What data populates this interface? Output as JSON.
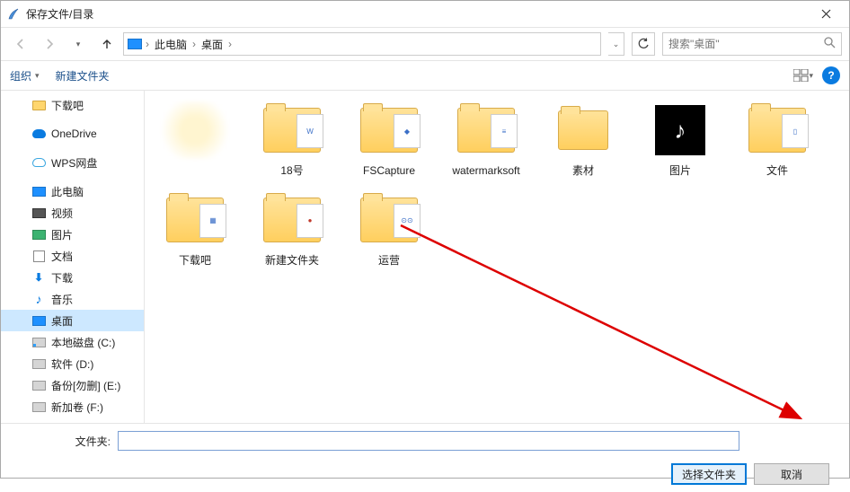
{
  "window": {
    "title": "保存文件/目录"
  },
  "breadcrumb": {
    "root": "此电脑",
    "current": "桌面"
  },
  "search": {
    "placeholder": "搜索\"桌面\""
  },
  "toolbar": {
    "organize": "组织",
    "newfolder": "新建文件夹"
  },
  "tree": {
    "downloads": "下载吧",
    "onedrive": "OneDrive",
    "wps": "WPS网盘",
    "pc": "此电脑",
    "video": "视频",
    "pictures": "图片",
    "documents": "文档",
    "downloads2": "下载",
    "music": "音乐",
    "desktop": "桌面",
    "driveC": "本地磁盘 (C:)",
    "driveD": "软件 (D:)",
    "driveE": "备份[勿删] (E:)",
    "driveF": "新加卷 (F:)"
  },
  "items": {
    "i1": "18号",
    "i2": "FSCapture",
    "i3": "watermarksoft",
    "i4": "素材",
    "i5": "图片",
    "i6": "文件",
    "i7": "下载吧",
    "i8": "新建文件夹",
    "i9": "运营"
  },
  "footer": {
    "folderLabel": "文件夹:",
    "folderValue": "",
    "select": "选择文件夹",
    "cancel": "取消"
  }
}
